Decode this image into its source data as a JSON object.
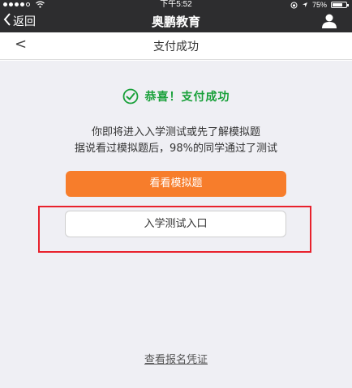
{
  "status_bar": {
    "time": "下午5:52",
    "battery": "75%",
    "battery_level": 0.75
  },
  "wechat_bar": {
    "back_label": "返回",
    "title": "奥鹏教育"
  },
  "page": {
    "back_symbol": "<",
    "title": "支付成功"
  },
  "content": {
    "success_message": "恭喜！支付成功",
    "description_line1": "你即将进入入学测试或先了解模拟题",
    "description_line2": "据说看过模拟题后，98%的同学通过了测试",
    "mock_exam_button": "看看模拟题",
    "entrance_test_button": "入学测试入口",
    "registration_link": "查看报名凭证"
  },
  "colors": {
    "success_green": "#18a039",
    "orange_button": "#f77d2b",
    "highlight_red": "#e8212c"
  },
  "icons": {
    "check": "check-circle-icon",
    "user": "user-icon",
    "back": "chevron-left-icon"
  }
}
